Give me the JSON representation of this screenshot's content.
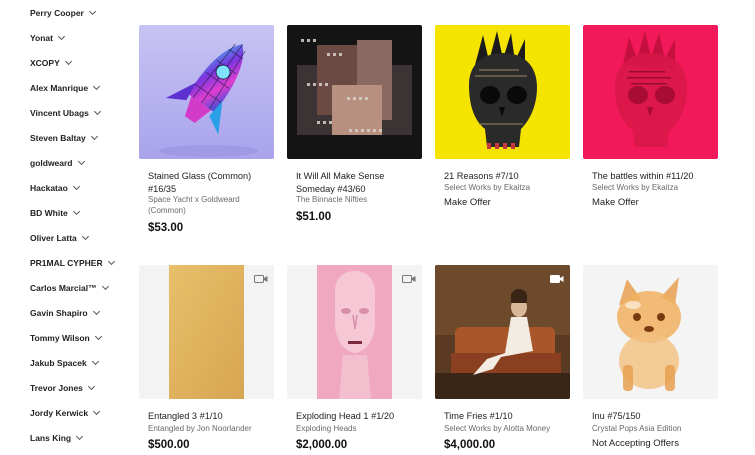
{
  "sidebar": {
    "items": [
      {
        "label": "Perry Cooper"
      },
      {
        "label": "Yonat"
      },
      {
        "label": "XCOPY"
      },
      {
        "label": "Alex Manrique"
      },
      {
        "label": "Vincent Ubags"
      },
      {
        "label": "Steven Baltay"
      },
      {
        "label": "goldweard"
      },
      {
        "label": "Hackatao"
      },
      {
        "label": "BD White"
      },
      {
        "label": "Oliver Latta"
      },
      {
        "label": "PR1MAL CYPHER"
      },
      {
        "label": "Carlos Marcial™"
      },
      {
        "label": "Gavin Shapiro"
      },
      {
        "label": "Tommy Wilson"
      },
      {
        "label": "Jakub Spacek"
      },
      {
        "label": "Trevor Jones"
      },
      {
        "label": "Jordy Kerwick"
      },
      {
        "label": "Lans King"
      }
    ]
  },
  "cards": [
    {
      "title": "Stained Glass (Common) #16/35",
      "subtitle": "Space Yacht x Goldweard (Common)",
      "price": "$53.00",
      "video": false
    },
    {
      "title": "It Will All Make Sense Someday #43/60",
      "subtitle": "The Binnacle Nifties",
      "price": "$51.00",
      "video": false
    },
    {
      "title": "21 Reasons #7/10",
      "subtitle": "Select Works by Ekaitza",
      "offer": "Make Offer",
      "video": false
    },
    {
      "title": "The battles within #11/20",
      "subtitle": "Select Works by Ekaitza",
      "offer": "Make Offer",
      "video": false
    },
    {
      "title": "Entangled 3 #1/10",
      "subtitle": "Entangled by Jon Noorlander",
      "price": "$500.00",
      "video": true
    },
    {
      "title": "Exploding Head 1 #1/20",
      "subtitle": "Exploding Heads",
      "price": "$2,000.00",
      "video": true
    },
    {
      "title": "Time Fries #1/10",
      "subtitle": "Select Works by Alotta Money",
      "price": "$4,000.00",
      "video": true
    },
    {
      "title": "Inu #75/150",
      "subtitle": "Crystal Pops Asia Edition",
      "offer": "Not Accepting Offers",
      "video": false
    }
  ]
}
